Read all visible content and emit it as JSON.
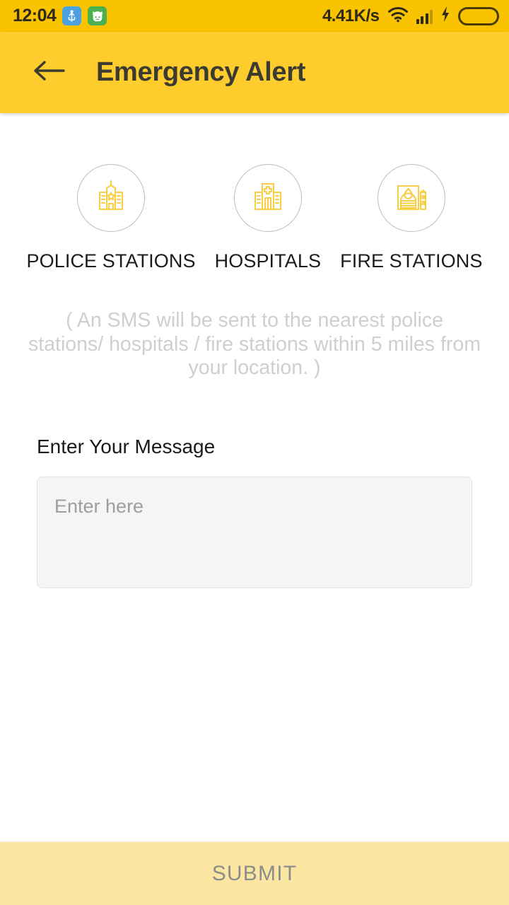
{
  "status_bar": {
    "clock": "12:04",
    "usb_icon": "usb-icon",
    "cat_icon": "cat-face-icon",
    "network_speed": "4.41K/s",
    "wifi_icon": "wifi-icon",
    "signal_icon": "cellular-signal-icon",
    "charging_icon": "lightning-bolt-icon",
    "battery_icon": "battery-full-icon",
    "background_color": "#F9C300"
  },
  "app_bar": {
    "back_icon": "arrow-left-icon",
    "title": "Emergency Alert",
    "background_color": "#FFCC2E"
  },
  "categories": [
    {
      "label": "POLICE STATIONS",
      "icon": "police-station-icon"
    },
    {
      "label": "HOSPITALS",
      "icon": "hospital-icon"
    },
    {
      "label": "FIRE STATIONS",
      "icon": "fire-station-icon"
    }
  ],
  "note": "( An SMS will be sent to the nearest police stations/ hospitals / fire stations within 5 miles from your location. )",
  "message": {
    "label": "Enter Your Message",
    "placeholder": "Enter here",
    "value": ""
  },
  "submit": {
    "label": "SUBMIT",
    "background_color": "#FBE6A2",
    "text_color": "#8C8C8C"
  },
  "theme": {
    "icon_yellow": "#F7CE46",
    "circle_border": "#BDBDBD"
  }
}
